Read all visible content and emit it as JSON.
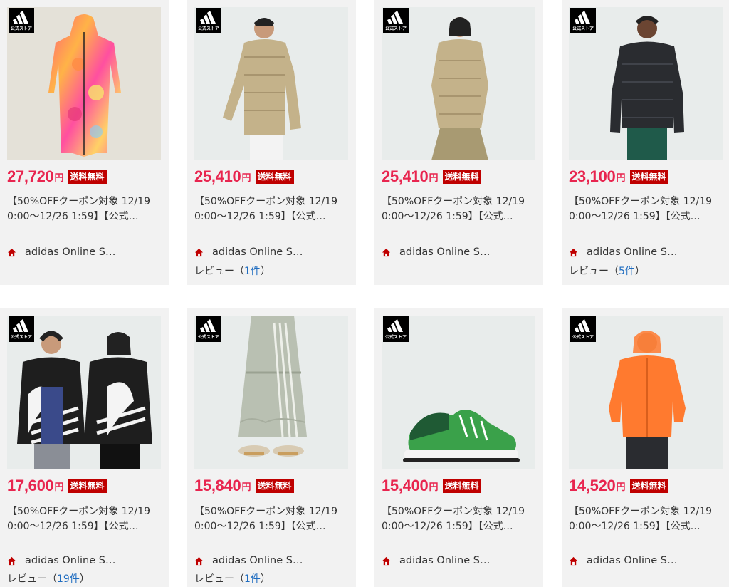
{
  "brand_badge": {
    "text": "公式ストア",
    "icon": "adidas-logo-icon"
  },
  "currency": "円",
  "shipping_label": "送料無料",
  "colors": {
    "price": "#e8254f",
    "shipping_bg": "#bf0000",
    "link": "#1e6cc0",
    "card_bg": "#f2f2f2"
  },
  "products": [
    {
      "price": "27,720",
      "title": "【50%OFFクーポン対象 12/19 0:00～12/26 1:59】【公式…",
      "shop": "adidas Online S…",
      "review_label": "",
      "review_count": ""
    },
    {
      "price": "25,410",
      "title": "【50%OFFクーポン対象 12/19 0:00～12/26 1:59】【公式…",
      "shop": "adidas Online S…",
      "review_label": "レビュー（",
      "review_count": "1件",
      "review_close": "）"
    },
    {
      "price": "25,410",
      "title": "【50%OFFクーポン対象 12/19 0:00～12/26 1:59】【公式…",
      "shop": "adidas Online S…",
      "review_label": "",
      "review_count": ""
    },
    {
      "price": "23,100",
      "title": "【50%OFFクーポン対象 12/19 0:00～12/26 1:59】【公式…",
      "shop": "adidas Online S…",
      "review_label": "レビュー（",
      "review_count": "5件",
      "review_close": "）"
    },
    {
      "price": "17,600",
      "title": "【50%OFFクーポン対象 12/19 0:00～12/26 1:59】【公式…",
      "shop": "adidas Online S…",
      "review_label": "レビュー（",
      "review_count": "19件",
      "review_close": "）"
    },
    {
      "price": "15,840",
      "title": "【50%OFFクーポン対象 12/19 0:00～12/26 1:59】【公式…",
      "shop": "adidas Online S…",
      "review_label": "レビュー（",
      "review_count": "1件",
      "review_close": "）"
    },
    {
      "price": "15,400",
      "title": "【50%OFFクーポン対象 12/19 0:00～12/26 1:59】【公式…",
      "shop": "adidas Online S…",
      "review_label": "",
      "review_count": ""
    },
    {
      "price": "14,520",
      "title": "【50%OFFクーポン対象 12/19 0:00～12/26 1:59】【公式…",
      "shop": "adidas Online S…",
      "review_label": "",
      "review_count": ""
    }
  ]
}
